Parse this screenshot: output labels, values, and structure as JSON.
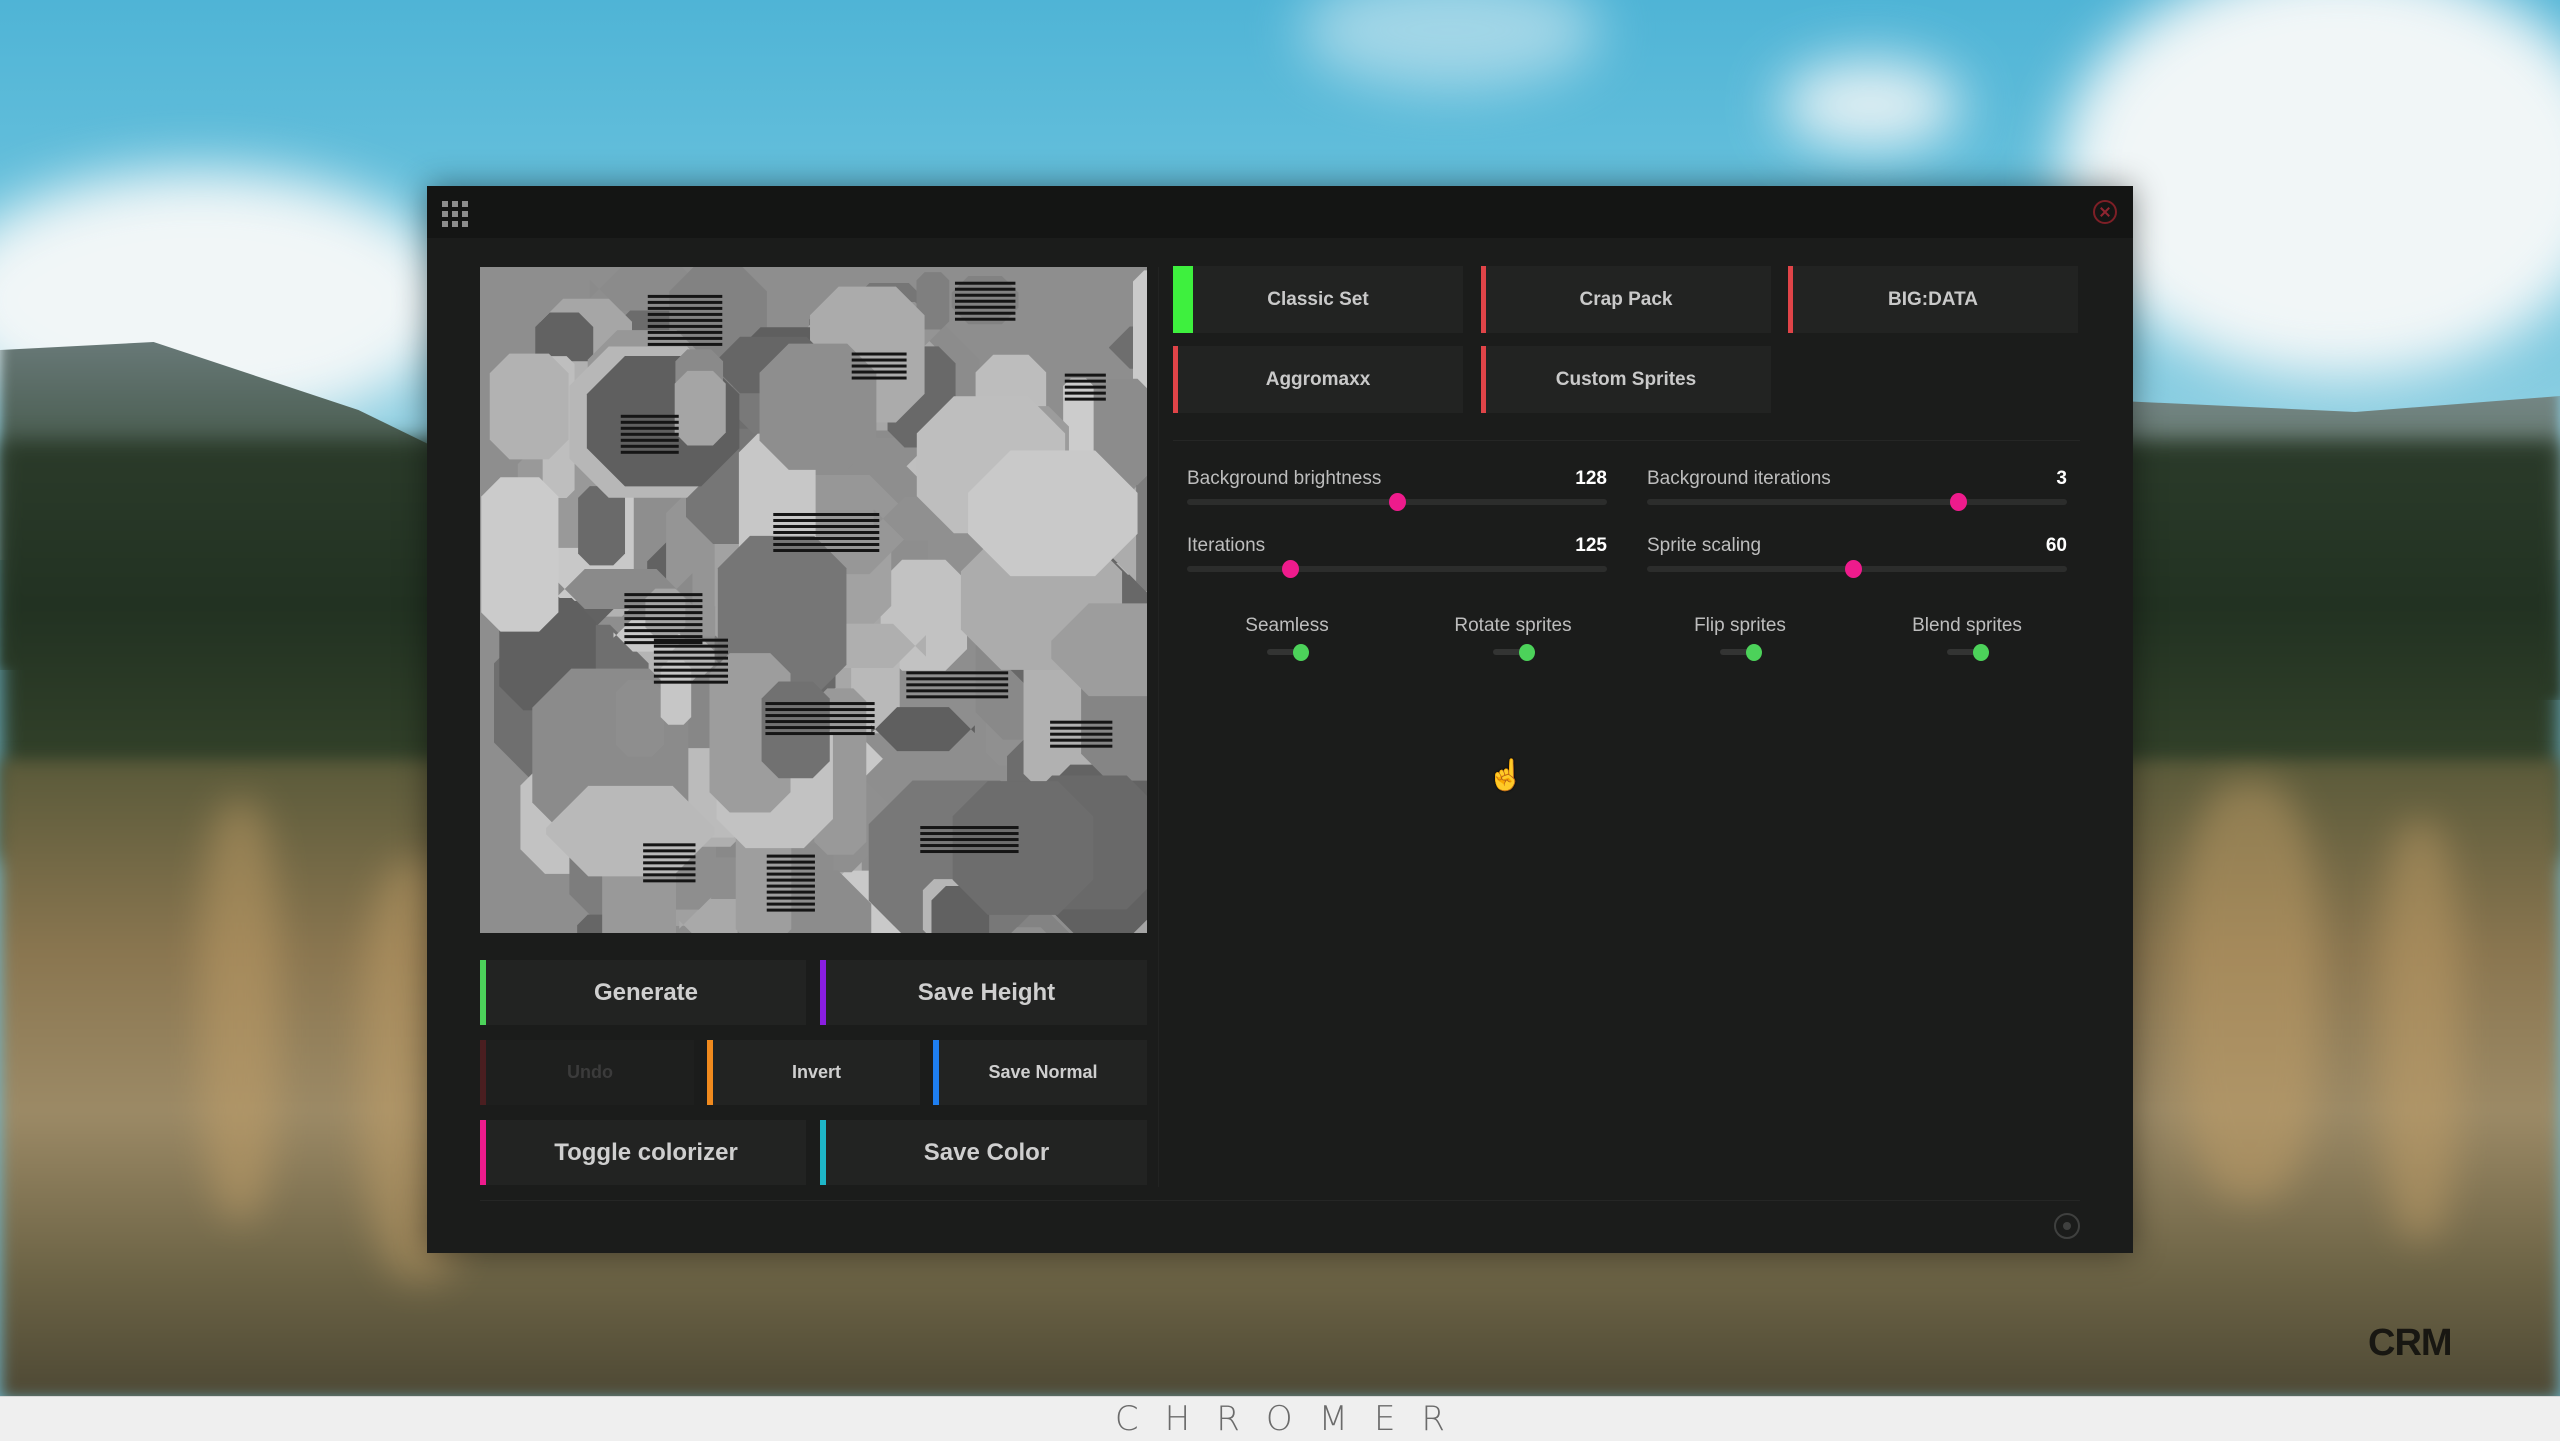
{
  "app": {
    "brand_footer": "CHROMER",
    "watermark": "CRM",
    "titlebar": {
      "menu_icon": "grid-icon",
      "close_icon": "close-circle-icon"
    },
    "preview": {
      "description": "Generated greyscale sci-fi height map texture",
      "cursor_icon": "hand-pointer-icon"
    },
    "presets": [
      {
        "label": "Classic Set",
        "active": true,
        "color": "#3ef03e"
      },
      {
        "label": "Crap Pack",
        "active": false,
        "color": "#e04448"
      },
      {
        "label": "BIG:DATA",
        "active": false,
        "color": "#e04448"
      },
      {
        "label": "Aggromaxx",
        "active": false,
        "color": "#e04448"
      },
      {
        "label": "Custom Sprites",
        "active": false,
        "color": "#e04448"
      }
    ],
    "sliders": [
      {
        "label": "Background brightness",
        "value": "128",
        "fraction": 0.5
      },
      {
        "label": "Background iterations",
        "value": "3",
        "fraction": 0.74
      },
      {
        "label": "Iterations",
        "value": "125",
        "fraction": 0.245
      },
      {
        "label": "Sprite scaling",
        "value": "60",
        "fraction": 0.49
      }
    ],
    "slider_thumb_color": "#ee1b8c",
    "toggles": [
      {
        "label": "Seamless",
        "on": true
      },
      {
        "label": "Rotate sprites",
        "on": true
      },
      {
        "label": "Flip sprites",
        "on": true
      },
      {
        "label": "Blend sprites",
        "on": true
      }
    ],
    "toggle_on_color": "#4cd25a",
    "actions": [
      {
        "label": "Generate",
        "color": "#4cd25a",
        "enabled": true
      },
      {
        "label": "Save Height",
        "color": "#8a1ee0",
        "enabled": true
      },
      {
        "label": "Undo",
        "color": "#4a1e20",
        "enabled": false
      },
      {
        "label": "Invert",
        "color": "#f08a1e",
        "enabled": true
      },
      {
        "label": "Save Normal",
        "color": "#1e7ef0",
        "enabled": true
      },
      {
        "label": "Toggle colorizer",
        "color": "#ee1b8c",
        "enabled": true
      },
      {
        "label": "Save Color",
        "color": "#1eb6c8",
        "enabled": true
      }
    ],
    "settings_icon": "settings-ring-icon"
  }
}
